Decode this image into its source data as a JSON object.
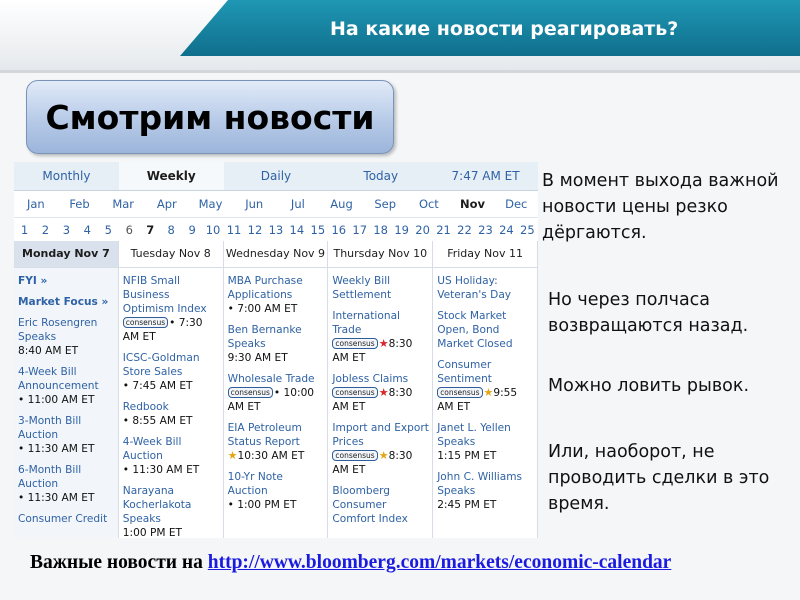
{
  "slide": {
    "title": "На какие новости реагировать?",
    "heading": "Смотрим новости"
  },
  "calendar": {
    "tabs": [
      "Monthly",
      "Weekly",
      "Daily",
      "Today",
      "7:47 AM ET"
    ],
    "active_tab": "Weekly",
    "months": [
      "Jan",
      "Feb",
      "Mar",
      "Apr",
      "May",
      "Jun",
      "Jul",
      "Aug",
      "Sep",
      "Oct",
      "Nov",
      "Dec"
    ],
    "active_month": "Nov",
    "days": [
      "1",
      "2",
      "3",
      "4",
      "5",
      "6",
      "7",
      "8",
      "9",
      "10",
      "11",
      "12",
      "13",
      "14",
      "15",
      "16",
      "17",
      "18",
      "19",
      "20",
      "21",
      "22",
      "23",
      "24",
      "25"
    ],
    "active_day": "7",
    "columns": [
      {
        "header": "Monday Nov 7",
        "events": [
          {
            "name": "FYI »",
            "time": ""
          },
          {
            "name": "Market Focus »",
            "time": ""
          },
          {
            "name": "Eric Rosengren Speaks",
            "time": "8:40 AM ET"
          },
          {
            "name": "4-Week Bill Announcement",
            "time": "• 11:00 AM ET"
          },
          {
            "name": "3-Month Bill Auction",
            "time": "• 11:30 AM ET"
          },
          {
            "name": "6-Month Bill Auction",
            "time": "• 11:30 AM ET"
          },
          {
            "name": "Consumer Credit",
            "time": ""
          }
        ]
      },
      {
        "header": "Tuesday Nov 8",
        "events": [
          {
            "name": "NFIB Small Business Optimism Index",
            "badge": "consensus",
            "time": "• 7:30 AM ET"
          },
          {
            "name": "ICSC-Goldman Store Sales",
            "time": "• 7:45 AM ET"
          },
          {
            "name": "Redbook",
            "time": "• 8:55 AM ET"
          },
          {
            "name": "4-Week Bill Auction",
            "time": "• 11:30 AM ET"
          },
          {
            "name": "Narayana Kocherlakota Speaks",
            "time": "1:00 PM ET"
          }
        ]
      },
      {
        "header": "Wednesday Nov 9",
        "events": [
          {
            "name": "MBA Purchase Applications",
            "time": "• 7:00 AM ET"
          },
          {
            "name": "Ben Bernanke Speaks",
            "time": "9:30 AM ET"
          },
          {
            "name": "Wholesale Trade",
            "badge": "consensus",
            "time": "• 10:00 AM ET"
          },
          {
            "name": "EIA Petroleum Status Report",
            "star": "gold",
            "time": "10:30 AM ET"
          },
          {
            "name": "10-Yr Note Auction",
            "time": "• 1:00 PM ET"
          }
        ]
      },
      {
        "header": "Thursday Nov 10",
        "events": [
          {
            "name": "Weekly Bill Settlement",
            "time": ""
          },
          {
            "name": "International Trade",
            "badge": "consensus",
            "star": "red",
            "time": "8:30 AM ET"
          },
          {
            "name": "Jobless Claims",
            "badge": "consensus",
            "star": "red",
            "time": "8:30 AM ET"
          },
          {
            "name": "Import and Export Prices",
            "badge": "consensus",
            "star": "gold",
            "time": "8:30 AM ET"
          },
          {
            "name": "Bloomberg Consumer Comfort Index",
            "time": ""
          }
        ]
      },
      {
        "header": "Friday Nov 11",
        "events": [
          {
            "name": "US Holiday: Veteran's Day",
            "time": ""
          },
          {
            "name": "Stock Market Open, Bond Market Closed",
            "time": ""
          },
          {
            "name": "Consumer Sentiment",
            "badge": "consensus",
            "star": "gold",
            "time": "9:55 AM ET"
          },
          {
            "name": "Janet L. Yellen Speaks",
            "time": "1:15 PM ET"
          },
          {
            "name": "John C. Williams Speaks",
            "time": "2:45 PM ET"
          }
        ]
      }
    ]
  },
  "notes": {
    "n1": "В момент выхода важной новости цены резко дёргаются.",
    "n2": "Но через полчаса возвращаются назад.",
    "n3": "Можно ловить рывок.",
    "n4": "Или, наоборот, не проводить сделки в это время."
  },
  "source": {
    "prefix": "Важные новости на ",
    "url": "http://www.bloomberg.com/markets/economic-calendar"
  }
}
